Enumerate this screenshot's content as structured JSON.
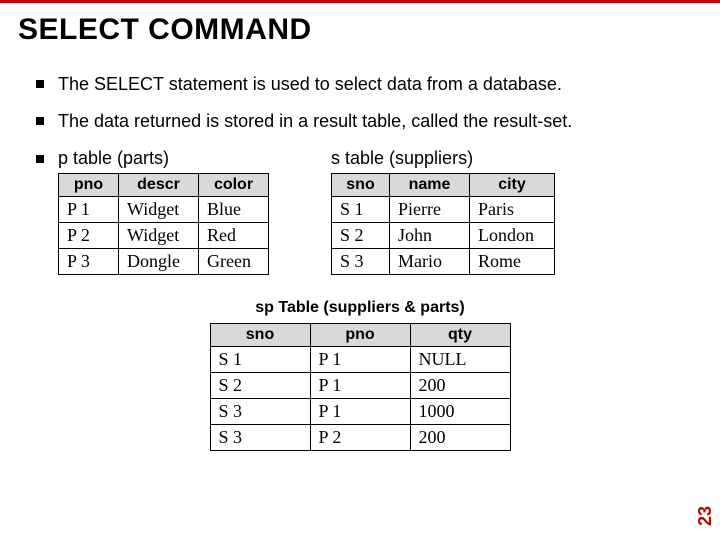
{
  "title_main": "SELECT COMMAND",
  "bullets": [
    "The SELECT statement is used to select data from a database.",
    "The data returned is stored in a result table, called the result-set."
  ],
  "p_table": {
    "caption": "p table (parts)",
    "headers": [
      "pno",
      "descr",
      "color"
    ],
    "rows": [
      [
        "P 1",
        "Widget",
        "Blue"
      ],
      [
        "P 2",
        "Widget",
        "Red"
      ],
      [
        "P 3",
        "Dongle",
        "Green"
      ]
    ]
  },
  "s_table": {
    "caption": "s table (suppliers)",
    "headers": [
      "sno",
      "name",
      "city"
    ],
    "rows": [
      [
        "S 1",
        "Pierre",
        "Paris"
      ],
      [
        "S 2",
        "John",
        "London"
      ],
      [
        "S 3",
        "Mario",
        "Rome"
      ]
    ]
  },
  "sp_table": {
    "caption": "sp Table (suppliers & parts)",
    "headers": [
      "sno",
      "pno",
      "qty"
    ],
    "rows": [
      [
        "S 1",
        "P 1",
        "NULL"
      ],
      [
        "S 2",
        "P 1",
        "200"
      ],
      [
        "S 3",
        "P 1",
        "1000"
      ],
      [
        "S 3",
        "P 2",
        "200"
      ]
    ]
  },
  "page_number": "23"
}
